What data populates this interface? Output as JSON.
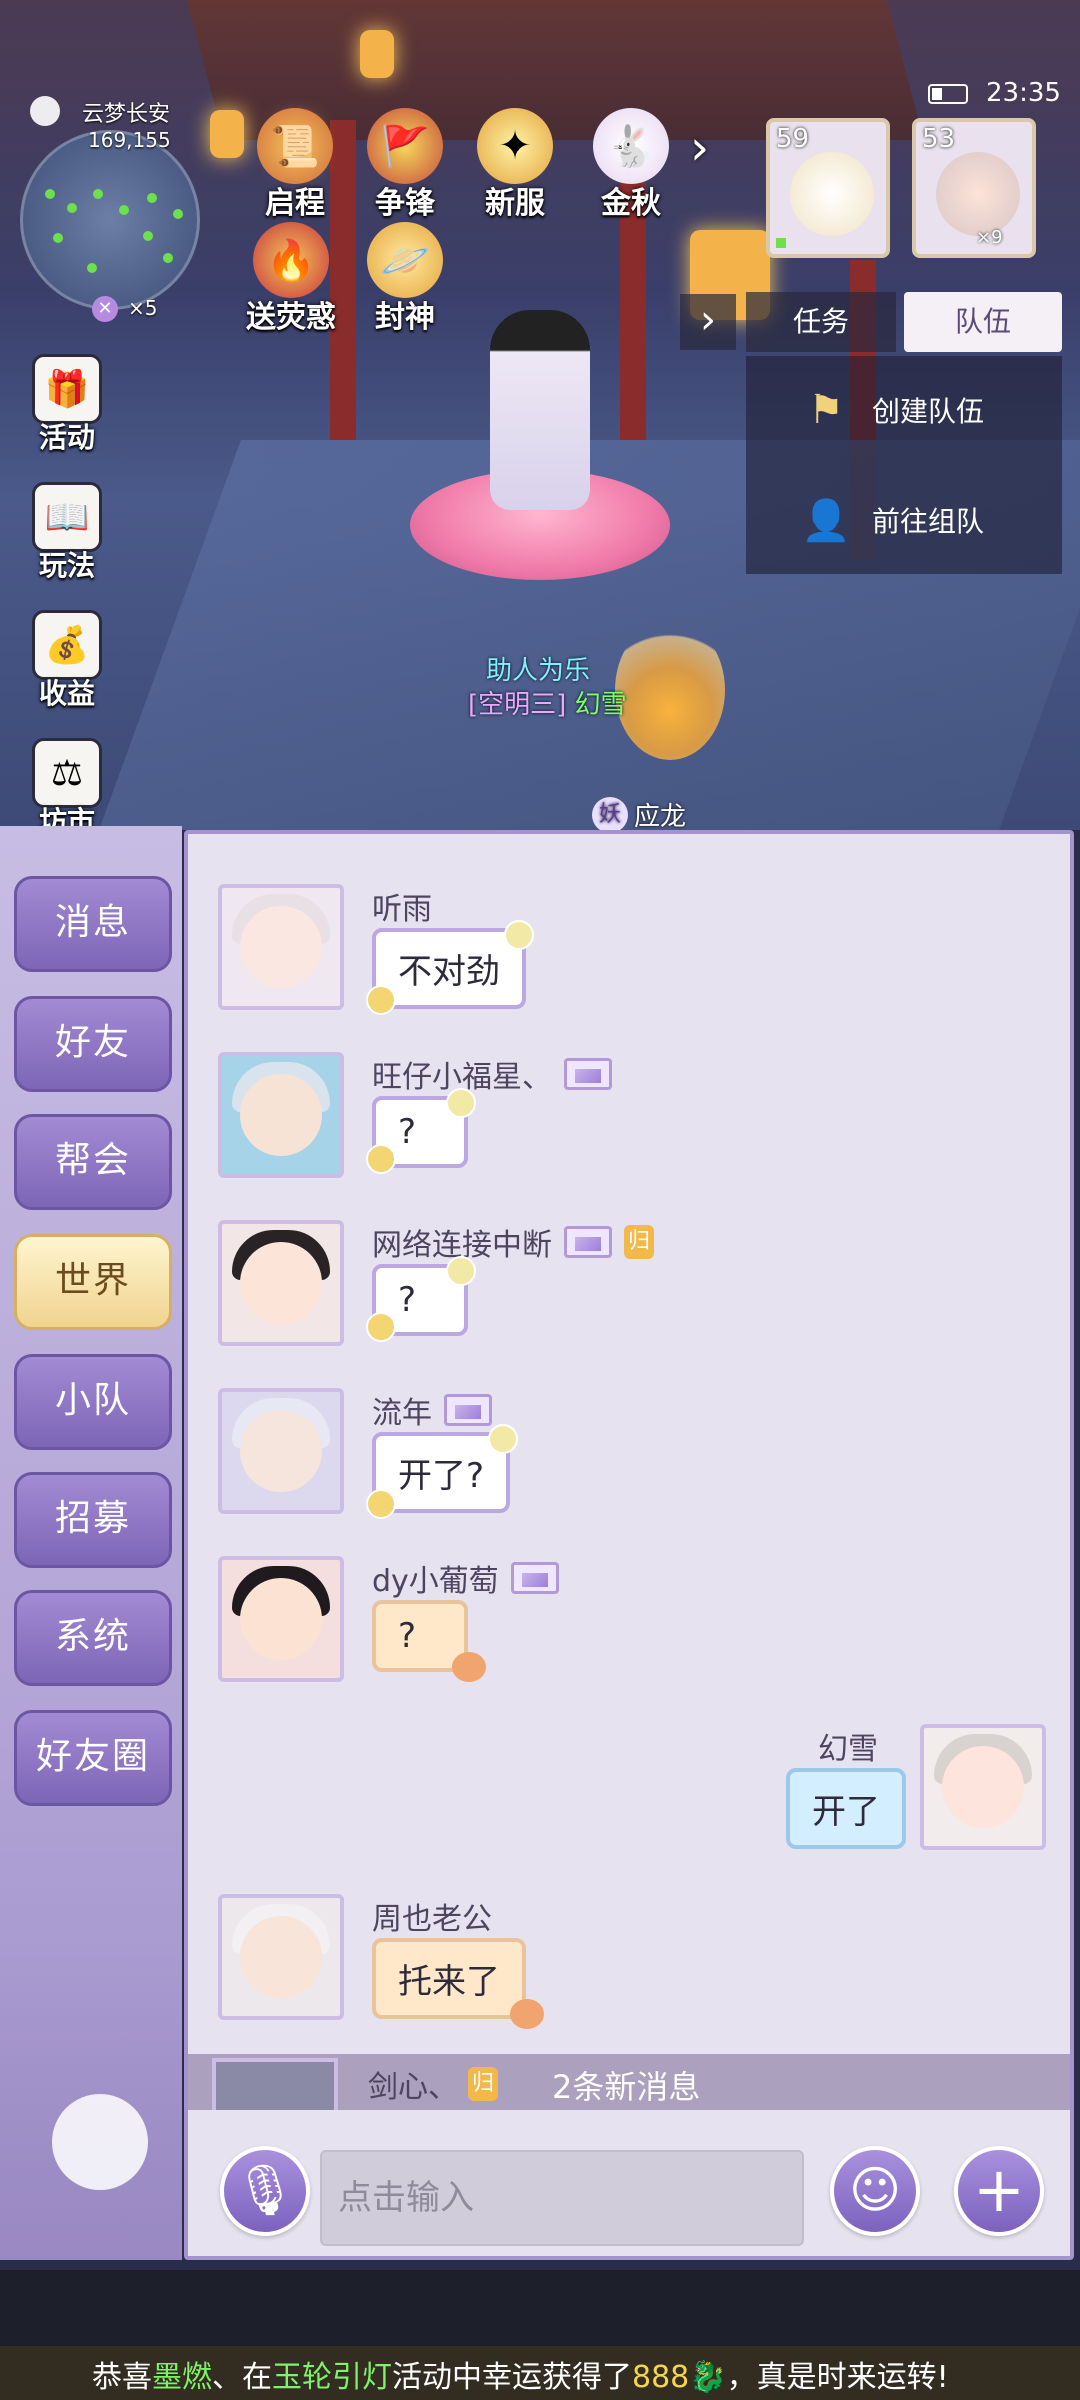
{
  "status": {
    "time": "23:35"
  },
  "minimap": {
    "city": "云梦长安",
    "coords": "169,155",
    "count": "×5"
  },
  "top_activities": [
    {
      "label": "启程",
      "icon": "scroll-icon"
    },
    {
      "label": "争锋",
      "icon": "flag-icon"
    },
    {
      "label": "新服",
      "icon": "star-icon"
    },
    {
      "label": "金秋",
      "icon": "rabbit-icon"
    },
    {
      "label": "送荧惑",
      "icon": "flame-mask-icon"
    },
    {
      "label": "封神",
      "icon": "planet-icon"
    }
  ],
  "portraits": [
    {
      "level": "59"
    },
    {
      "level": "53",
      "sub": "×9"
    }
  ],
  "panel": {
    "tab_task": "任务",
    "tab_team": "队伍",
    "create_team": "创建队伍",
    "join_team": "前往组队"
  },
  "game_menu": [
    {
      "label": "活动"
    },
    {
      "label": "玩法"
    },
    {
      "label": "收益"
    },
    {
      "label": "坊市"
    }
  ],
  "scene_tags": {
    "player_title": "助人为乐",
    "player_team": "[空明三]",
    "player_name": "幻雪",
    "pet_prefix": "妖",
    "pet_name": "应龙"
  },
  "channels": [
    {
      "label": "消息",
      "active": false
    },
    {
      "label": "好友",
      "active": false
    },
    {
      "label": "帮会",
      "active": false
    },
    {
      "label": "世界",
      "active": true
    },
    {
      "label": "小队",
      "active": false
    },
    {
      "label": "招募",
      "active": false
    },
    {
      "label": "系统",
      "active": false
    },
    {
      "label": "好友圈",
      "active": false
    }
  ],
  "messages": [
    {
      "sender": "听雨",
      "text": "不对劲",
      "pic_badge": false,
      "gui_badge": false,
      "self": false
    },
    {
      "sender": "旺仔小福星、",
      "text": "?",
      "pic_badge": true,
      "gui_badge": false,
      "self": false
    },
    {
      "sender": "网络连接中断",
      "text": "?",
      "pic_badge": true,
      "gui_badge": true,
      "gui_text": "归",
      "self": false
    },
    {
      "sender": "流年",
      "text": "开了?",
      "pic_badge": true,
      "gui_badge": false,
      "self": false
    },
    {
      "sender": "dy小葡萄",
      "text": "?",
      "pic_badge": true,
      "gui_badge": false,
      "self": false
    },
    {
      "sender": "幻雪",
      "text": "开了",
      "self": true
    },
    {
      "sender": "周也老公",
      "text": "托来了",
      "pic_badge": false,
      "gui_badge": false,
      "self": false
    }
  ],
  "new_messages": {
    "sender": "剑心、",
    "gui": "归",
    "text": "2条新消息"
  },
  "input": {
    "placeholder": "点击输入"
  },
  "ticker": {
    "prefix": "恭喜",
    "player": "墨燃",
    "mid1": "、在",
    "event": "玉轮引灯",
    "mid2": "活动中幸运获得了",
    "amount": "888",
    "suffix": "，真是时来运转!"
  },
  "colors": {
    "channel_active": "#f0d38f",
    "channel_inactive": "#8a72c4",
    "chat_bg": "#e6e2ef",
    "bubble_border": "#bca8e0"
  }
}
